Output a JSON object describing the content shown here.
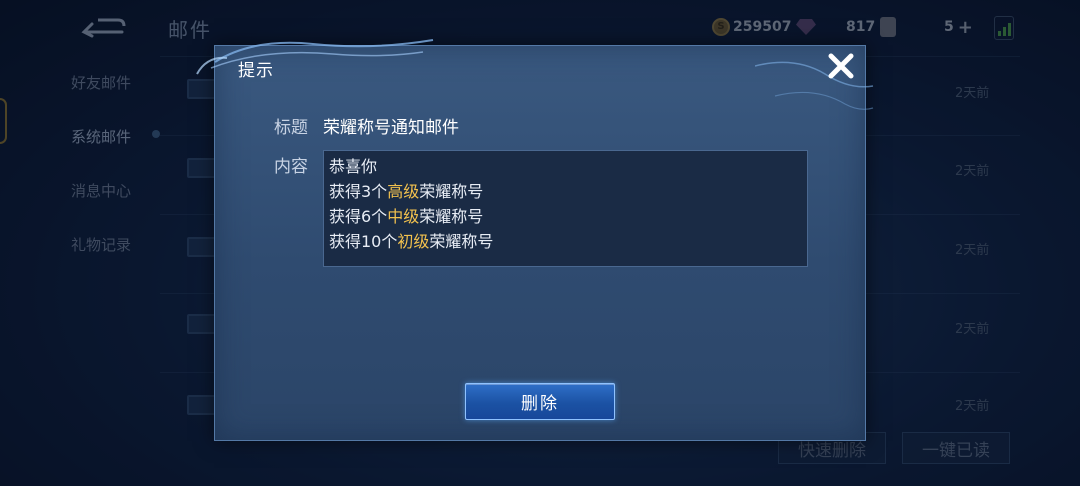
{
  "header": {
    "title": "邮件",
    "gold": "259507",
    "diamonds": "817",
    "vouchers": "5"
  },
  "sidebar": {
    "items": [
      {
        "label": "好友邮件"
      },
      {
        "label": "系统邮件"
      },
      {
        "label": "消息中心"
      },
      {
        "label": "礼物记录"
      }
    ]
  },
  "mail_list": {
    "rows": [
      {
        "time": "2天前"
      },
      {
        "time": "2天前"
      },
      {
        "time": "2天前"
      },
      {
        "time": "2天前"
      },
      {
        "time": "2天前"
      }
    ],
    "quick_delete_label": "快速删除",
    "read_all_label": "一键已读"
  },
  "dialog": {
    "title": "提示",
    "subject_label": "标题",
    "subject_value": "荣耀称号通知邮件",
    "content_label": "内容",
    "content_lines": [
      {
        "pre": "恭喜你",
        "hl": "",
        "post": ""
      },
      {
        "pre": "获得3个",
        "hl": "高级",
        "post": "荣耀称号"
      },
      {
        "pre": "获得6个",
        "hl": "中级",
        "post": "荣耀称号"
      },
      {
        "pre": "获得10个",
        "hl": "初级",
        "post": "荣耀称号"
      }
    ],
    "delete_label": "删除"
  },
  "colors": {
    "highlight": "#f2c14e",
    "dialog_bg": "#34527a",
    "button_blue": "#1f5bb0"
  }
}
